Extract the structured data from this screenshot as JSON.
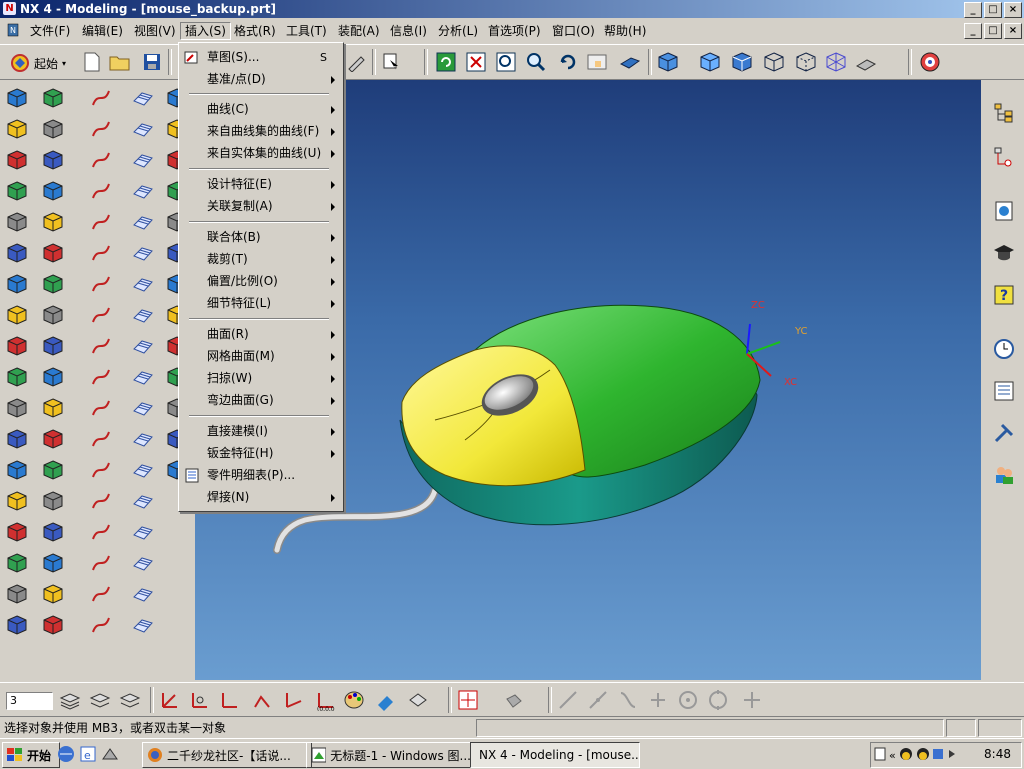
{
  "window": {
    "title": "NX 4 - Modeling - [mouse_backup.prt]",
    "icon": "nx-app-icon"
  },
  "window_controls": [
    "_",
    "□",
    "×"
  ],
  "menubar": {
    "items": [
      "文件(F)",
      "编辑(E)",
      "视图(V)",
      "插入(S)",
      "格式(R)",
      "工具(T)",
      "装配(A)",
      "信息(I)",
      "分析(L)",
      "首选项(P)",
      "窗口(O)",
      "帮助(H)"
    ],
    "active": "插入(S)"
  },
  "toolbar": {
    "start_label": "起始"
  },
  "insert_menu": {
    "items": [
      {
        "label": "草图(S)...",
        "shortcut": "S",
        "submenu": false,
        "icon": "sketch-icon"
      },
      {
        "label": "基准/点(D)",
        "submenu": true
      },
      {
        "label": "曲线(C)",
        "submenu": true
      },
      {
        "label": "来自曲线集的曲线(F)",
        "submenu": true
      },
      {
        "label": "来自实体集的曲线(U)",
        "submenu": true
      },
      {
        "label": "设计特征(E)",
        "submenu": true
      },
      {
        "label": "关联复制(A)",
        "submenu": true
      },
      {
        "label": "联合体(B)",
        "submenu": true
      },
      {
        "label": "裁剪(T)",
        "submenu": true
      },
      {
        "label": "偏置/比例(O)",
        "submenu": true
      },
      {
        "label": "细节特征(L)",
        "submenu": true
      },
      {
        "label": "曲面(R)",
        "submenu": true
      },
      {
        "label": "网格曲面(M)",
        "submenu": true
      },
      {
        "label": "扫掠(W)",
        "submenu": true
      },
      {
        "label": "弯边曲面(G)",
        "submenu": true
      },
      {
        "label": "直接建模(I)",
        "submenu": true
      },
      {
        "label": "钣金特征(H)",
        "submenu": true
      },
      {
        "label": "零件明细表(P)...",
        "submenu": false,
        "icon": "parts-list-icon"
      },
      {
        "label": "焊接(N)",
        "submenu": true
      }
    ]
  },
  "viewport": {
    "axes": {
      "zc": "ZC",
      "yc": "YC",
      "xc": "XC"
    },
    "model": "computer-mouse",
    "colors": {
      "shell_top": "#2fb52f",
      "button_top": "#f2e83a",
      "base": "#1a8a7a",
      "scroll": "#b0b0b0",
      "cable": "#d8d8d8"
    }
  },
  "bottom_toolbar": {
    "layer_combo": "3"
  },
  "status": {
    "prompt": "选择对象并使用 MB3，或者双击某一对象"
  },
  "taskbar": {
    "start": "开始",
    "tasks": [
      {
        "label": "二千纱龙社区-【话说...",
        "active": false
      },
      {
        "label": "无标题-1 - Windows 图...",
        "active": false
      },
      {
        "label": "NX 4 - Modeling - [mouse...",
        "active": true
      }
    ],
    "clock": "8:48"
  }
}
